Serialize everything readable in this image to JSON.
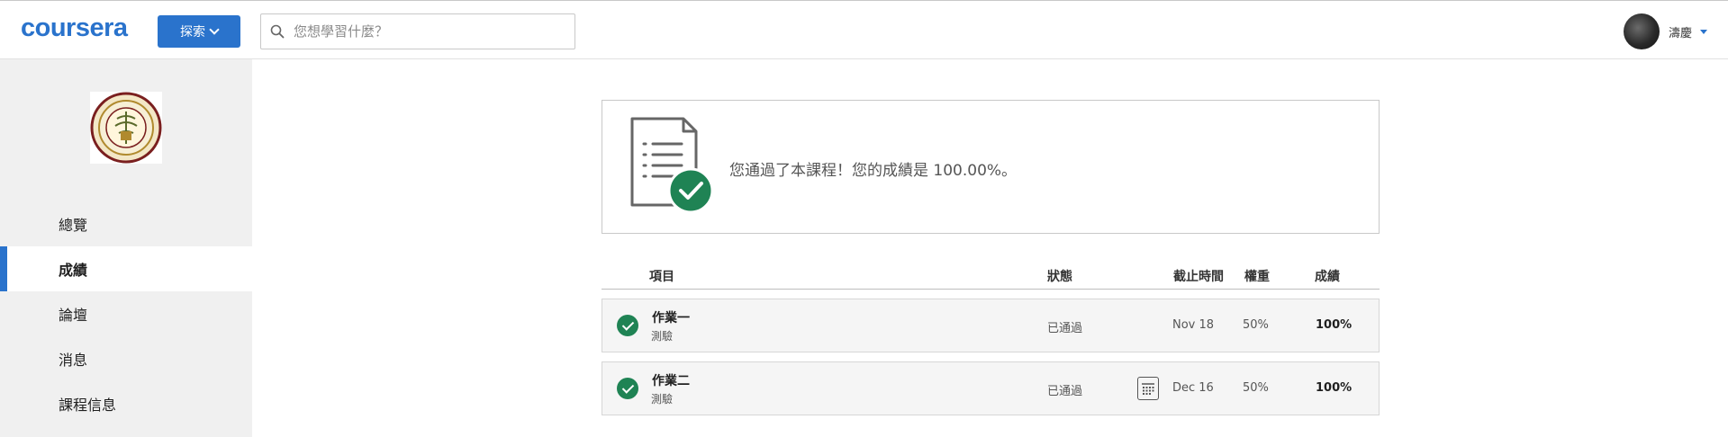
{
  "header": {
    "logo": "coursera",
    "explore_label": "探索",
    "search_placeholder": "您想學習什麼？",
    "user_name": "濤慶"
  },
  "sidebar": {
    "items": [
      {
        "label": "總覽",
        "active": false
      },
      {
        "label": "成績",
        "active": true
      },
      {
        "label": "論壇",
        "active": false
      },
      {
        "label": "消息",
        "active": false
      },
      {
        "label": "課程信息",
        "active": false
      }
    ]
  },
  "pass_card": {
    "message": "您通過了本課程！您的成績是 100.00%。"
  },
  "table": {
    "headers": {
      "item": "項目",
      "status": "狀態",
      "due": "截止時間",
      "weight": "權重",
      "grade": "成績"
    },
    "rows": [
      {
        "name": "作業一",
        "type": "測驗",
        "status": "已通過",
        "due": "Nov 18",
        "weight": "50%",
        "grade": "100%",
        "calendar_icon": false
      },
      {
        "name": "作業二",
        "type": "測驗",
        "status": "已通過",
        "due": "Dec 16",
        "weight": "50%",
        "grade": "100%",
        "calendar_icon": true
      }
    ]
  },
  "colors": {
    "brand": "#2a73cc",
    "success": "#1f8354"
  }
}
